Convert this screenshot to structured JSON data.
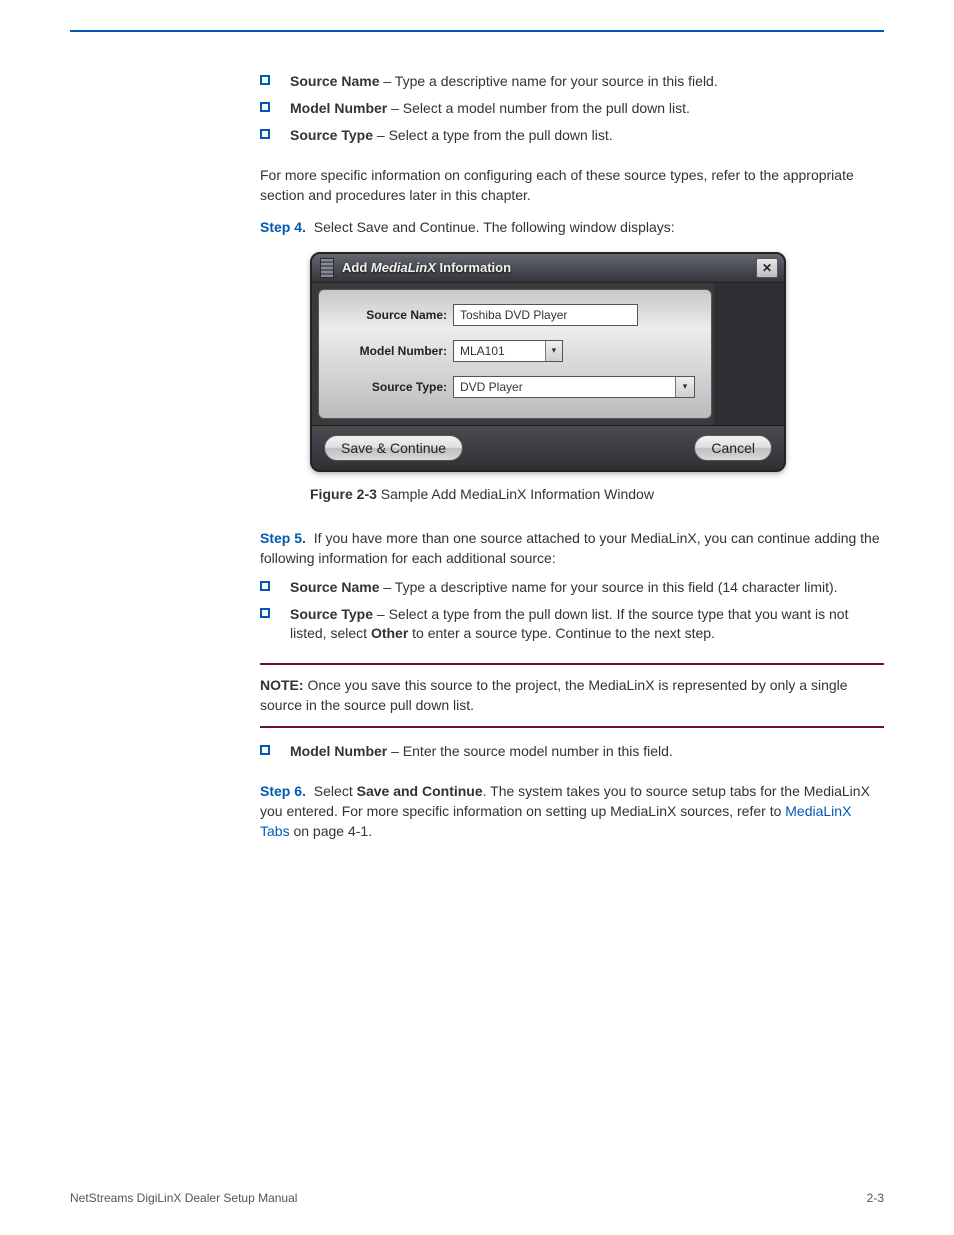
{
  "page": {
    "footer_left": "NetStreams DigiLinX Dealer Setup Manual",
    "page_number": "2-3"
  },
  "list1": {
    "b1_a": "Source Name",
    "b1_b": " – Type a descriptive name for your source in this field.",
    "b2_a": "Model Number",
    "b2_b": " – Select a model number from the pull down list.",
    "b3_a": "Source Type",
    "b3_b": " – Select a type from the pull down list."
  },
  "para1": "For more specific information on configuring each of these source types, refer to the appropriate section and procedures later in this chapter.",
  "step4_label": "Step 4.",
  "step4_text": " Select Save and Continue. The following window displays:",
  "figure_label": "Figure 2-3",
  "figure_caption": " Sample Add MediaLinX Information Window",
  "dialog": {
    "title_prefix": "Add ",
    "title_accent": "MediaLinX",
    "title_suffix": " Information",
    "source_name_label": "Source Name:",
    "source_name_value": "Toshiba DVD Player",
    "model_number_label": "Model Number:",
    "model_number_value": "MLA101",
    "source_type_label": "Source Type:",
    "source_type_value": "DVD Player",
    "save_button": "Save & Continue",
    "cancel_button": "Cancel",
    "close_glyph": "✕"
  },
  "step5_label": "Step 5.",
  "step5_text": " If you have more than one source attached to your MediaLinX, you can continue adding the following information for each additional source:",
  "list2": {
    "b1_a": "Source Name",
    "b1_b": " – Type a descriptive name for your source in this field (14 character limit).",
    "b2_a": "Source Type",
    "b2_b": " – Select a type from the pull down list. If the source type that you want is not listed, select ",
    "b2_c": "Other",
    "b2_d": " to enter a source type. Continue to the next step."
  },
  "note": {
    "label": "NOTE:",
    "text": " Once you save this source to the project, the MediaLinX is represented by only a single source in the source pull down list.",
    "b_a": "Model Number",
    "b_b": " – Enter the source model number in this field."
  },
  "step6_label": "Step 6.",
  "step6_text_a": " Select ",
  "step6_text_b": "Save and Continue",
  "step6_text_c": ". The system takes you to source setup tabs for the MediaLinX you entered. For more specific information on setting up MediaLinX sources, refer to ",
  "step6_link": "MediaLinX Tabs",
  "step6_text_d": " on page 4-1."
}
